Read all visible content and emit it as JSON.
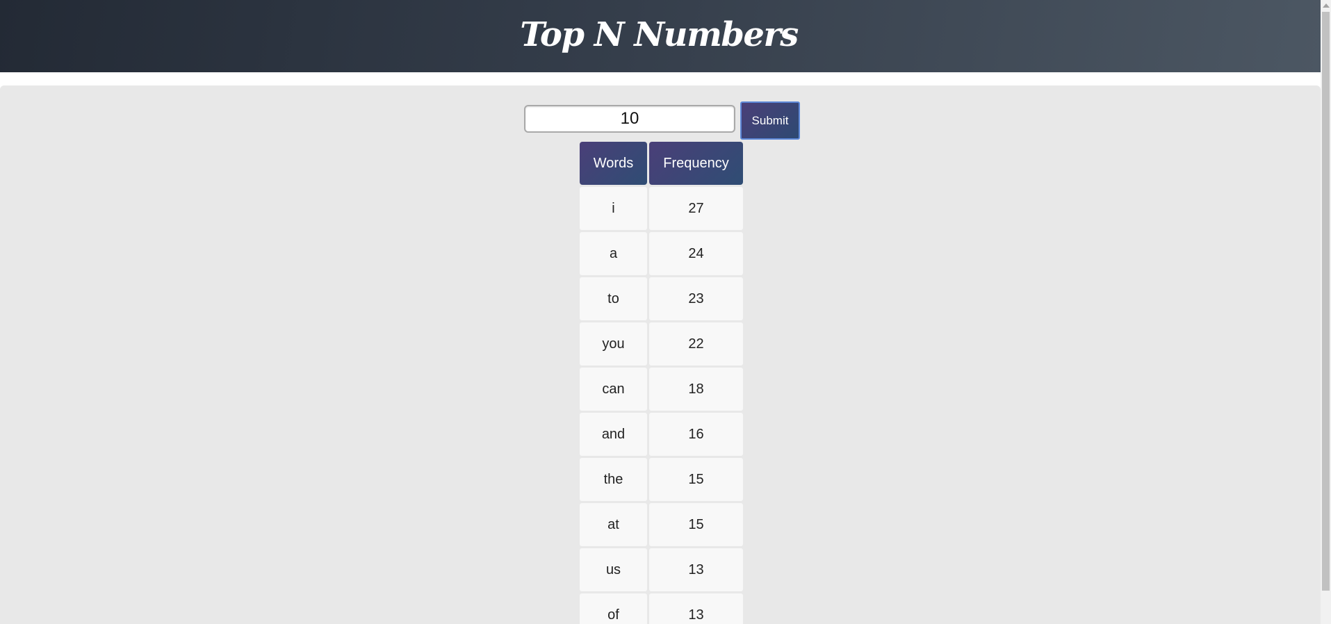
{
  "header": {
    "title": "Top N Numbers"
  },
  "controls": {
    "n_value": "10",
    "submit_label": "Submit"
  },
  "table": {
    "headers": {
      "words": "Words",
      "frequency": "Frequency"
    },
    "rows": [
      {
        "word": "i",
        "frequency": "27"
      },
      {
        "word": "a",
        "frequency": "24"
      },
      {
        "word": "to",
        "frequency": "23"
      },
      {
        "word": "you",
        "frequency": "22"
      },
      {
        "word": "can",
        "frequency": "18"
      },
      {
        "word": "and",
        "frequency": "16"
      },
      {
        "word": "the",
        "frequency": "15"
      },
      {
        "word": "at",
        "frequency": "15"
      },
      {
        "word": "us",
        "frequency": "13"
      },
      {
        "word": "of",
        "frequency": "13"
      }
    ]
  }
}
